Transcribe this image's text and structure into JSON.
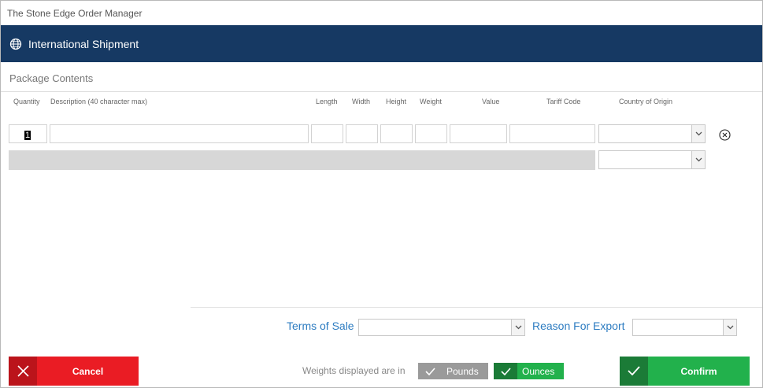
{
  "window": {
    "title": "The Stone Edge Order Manager"
  },
  "header": {
    "title": "International Shipment",
    "icon": "globe-icon",
    "color": "#163963"
  },
  "package": {
    "section_label": "Package Contents",
    "columns": {
      "quantity": "Quantity",
      "description": "Description (40 character max)",
      "length": "Length",
      "width": "Width",
      "height": "Height",
      "weight": "Weight",
      "value": "Value",
      "tariff_code": "Tariff Code",
      "country_of_origin": "Country of Origin"
    },
    "rows": [
      {
        "quantity": "1",
        "description": "",
        "length": "",
        "width": "",
        "height": "",
        "weight": "",
        "value": "",
        "tariff_code": "",
        "country_of_origin": ""
      }
    ],
    "new_row": {
      "country_of_origin": ""
    }
  },
  "footer": {
    "terms_of_sale_label": "Terms of Sale",
    "terms_of_sale_value": "",
    "reason_for_export_label": "Reason For Export",
    "reason_for_export_value": "",
    "weights_label": "Weights displayed are in",
    "pounds_label": "Pounds",
    "ounces_label": "Ounces",
    "selected_unit": "Ounces",
    "cancel_label": "Cancel",
    "confirm_label": "Confirm"
  },
  "colors": {
    "accent_blue": "#2d7cc1",
    "cancel_red": "#ea1c24",
    "confirm_green": "#22b14c",
    "unselected_gray": "#9a9a9a"
  }
}
